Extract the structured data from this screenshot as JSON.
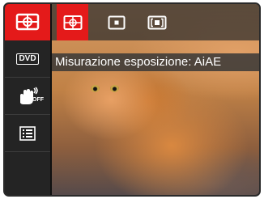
{
  "sidebar": {
    "items": [
      {
        "icon": "metering-icon",
        "active": true
      },
      {
        "icon": "dvd-icon",
        "label": "DVD"
      },
      {
        "icon": "hand-stabilizer-off-icon",
        "label": "OFF"
      },
      {
        "icon": "menu-list-icon"
      }
    ]
  },
  "options": [
    {
      "icon": "metering-aiae-icon",
      "active": true
    },
    {
      "icon": "metering-spot-icon"
    },
    {
      "icon": "metering-center-icon"
    }
  ],
  "caption": {
    "text": "Misurazione esposizione: AiAE"
  },
  "colors": {
    "accent": "#e41a1a",
    "sidebar_bg": "#242424"
  }
}
